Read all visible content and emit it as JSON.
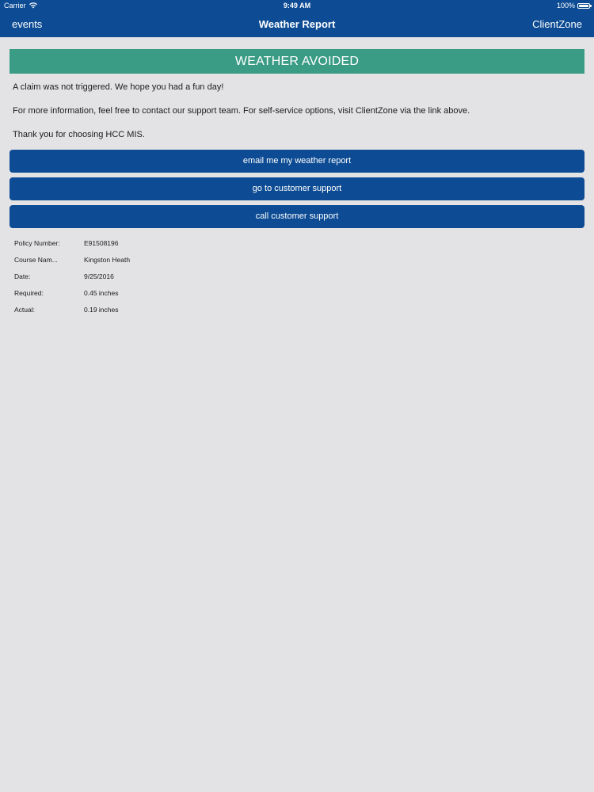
{
  "status_bar": {
    "carrier": "Carrier",
    "time": "9:49 AM",
    "battery": "100%"
  },
  "nav": {
    "back_label": "events",
    "title": "Weather Report",
    "right_label": "ClientZone"
  },
  "banner": {
    "text": "WEATHER AVOIDED",
    "color": "#3b9c86"
  },
  "messages": [
    "A claim was not triggered. We hope you had a fun day!",
    "For more information, feel free to contact our support team. For self-service options, visit ClientZone via the link above.",
    "Thank you for choosing HCC MIS."
  ],
  "buttons": {
    "email_report": "email me my weather report",
    "customer_support": "go to customer support",
    "call_support": "call customer support"
  },
  "details": [
    {
      "label": "Policy Number:",
      "value": "E91508196"
    },
    {
      "label": "Course Nam...",
      "value": "Kingston Heath"
    },
    {
      "label": "Date:",
      "value": "9/25/2016"
    },
    {
      "label": "Required:",
      "value": "0.45 inches"
    },
    {
      "label": "Actual:",
      "value": "0.19 inches"
    }
  ],
  "colors": {
    "primary": "#0d4c94",
    "background": "#e3e3e5"
  },
  "icons": {
    "wifi": "wifi-icon",
    "battery": "battery-icon"
  }
}
